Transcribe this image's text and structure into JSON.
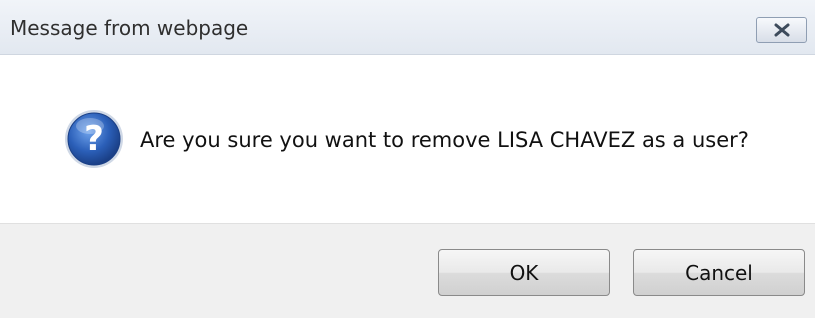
{
  "window": {
    "title": "Message from webpage",
    "close_icon": "close-icon"
  },
  "dialog": {
    "icon": "question-icon",
    "message": "Are you sure you want to remove LISA CHAVEZ as a user?"
  },
  "buttons": {
    "ok_label": "OK",
    "cancel_label": "Cancel"
  },
  "colors": {
    "icon_blue": "#2b5fb8",
    "footer_bg": "#f0f0f0"
  }
}
